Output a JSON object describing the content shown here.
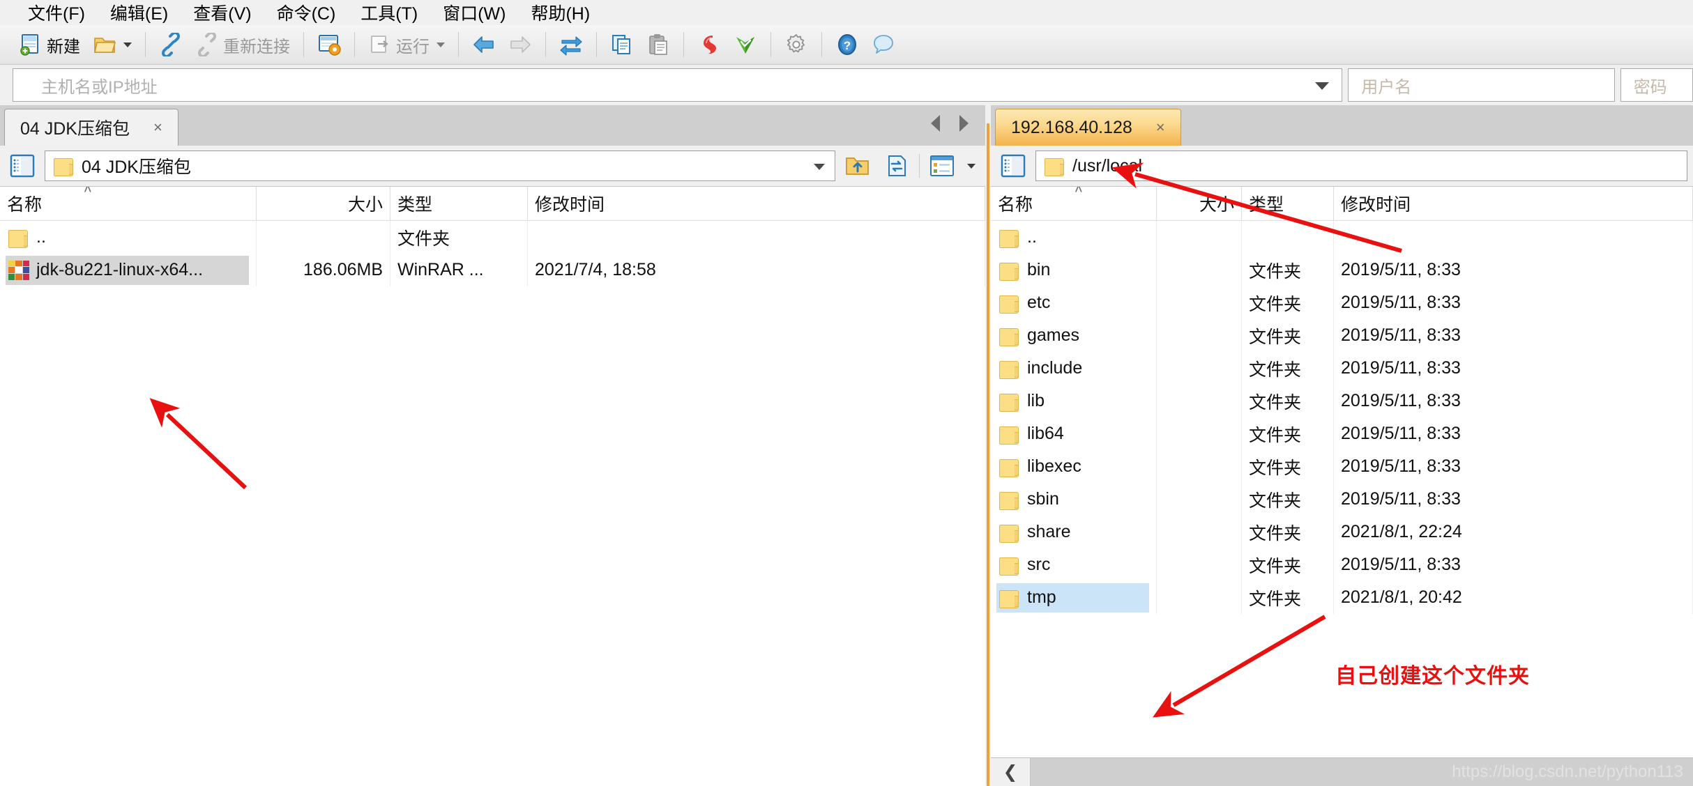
{
  "menubar": {
    "items": [
      {
        "label": "文件(F)",
        "name": "menu-file"
      },
      {
        "label": "编辑(E)",
        "name": "menu-edit"
      },
      {
        "label": "查看(V)",
        "name": "menu-view"
      },
      {
        "label": "命令(C)",
        "name": "menu-command"
      },
      {
        "label": "工具(T)",
        "name": "menu-tools"
      },
      {
        "label": "窗口(W)",
        "name": "menu-window"
      },
      {
        "label": "帮助(H)",
        "name": "menu-help"
      }
    ]
  },
  "toolbar": {
    "new_label": "新建",
    "reconnect_label": "重新连接",
    "run_label": "运行",
    "icons": {
      "new": "new-document-icon",
      "open": "open-folder-icon",
      "connect": "connect-icon",
      "disconnect": "disconnect-icon",
      "transfer": "transfer-window-icon",
      "run": "run-icon",
      "back": "back-arrow-icon",
      "forward": "forward-arrow-icon",
      "sync": "sync-transfer-icon",
      "copy": "copy-icon",
      "paste": "paste-icon",
      "xshell": "xshell-icon",
      "xftp": "xftp-icon",
      "settings": "gear-icon",
      "help": "help-icon",
      "feedback": "feedback-icon"
    }
  },
  "hostbar": {
    "host_placeholder": "主机名或IP地址",
    "user_placeholder": "用户名",
    "password_placeholder": "密码"
  },
  "left_pane": {
    "tab": {
      "label": "04 JDK压缩包",
      "close": "×",
      "active": false
    },
    "address": {
      "path": "04 JDK压缩包"
    },
    "buttons": {
      "toggle_tree": "tree-toggle-icon",
      "up": "up-folder-icon",
      "refresh": "refresh-icon",
      "view": "view-mode-icon"
    },
    "columns": [
      {
        "key": "name",
        "label": "名称",
        "align": "left",
        "sorted": true
      },
      {
        "key": "size",
        "label": "大小",
        "align": "right",
        "sorted": false
      },
      {
        "key": "type",
        "label": "类型",
        "align": "left",
        "sorted": false
      },
      {
        "key": "mtime",
        "label": "修改时间",
        "align": "left",
        "sorted": false
      }
    ],
    "rows": [
      {
        "icon": "folder",
        "name": "..",
        "size": "",
        "type": "文件夹",
        "mtime": "",
        "selected": false
      },
      {
        "icon": "rar",
        "name": "jdk-8u221-linux-x64...",
        "size": "186.06MB",
        "type": "WinRAR ...",
        "mtime": "2021/7/4, 18:58",
        "selected": true
      }
    ]
  },
  "right_pane": {
    "tab": {
      "label": "192.168.40.128",
      "close": "×",
      "active": true
    },
    "address": {
      "path": "/usr/local"
    },
    "buttons": {
      "toggle_tree": "tree-toggle-icon"
    },
    "columns": [
      {
        "key": "name",
        "label": "名称",
        "align": "left",
        "sorted": true
      },
      {
        "key": "size",
        "label": "大小",
        "align": "right",
        "sorted": false
      },
      {
        "key": "type",
        "label": "类型",
        "align": "left",
        "sorted": false
      },
      {
        "key": "mtime",
        "label": "修改时间",
        "align": "left",
        "sorted": false
      }
    ],
    "rows": [
      {
        "icon": "folder",
        "name": "..",
        "size": "",
        "type": "",
        "mtime": "",
        "selected": false
      },
      {
        "icon": "folder",
        "name": "bin",
        "size": "",
        "type": "文件夹",
        "mtime": "2019/5/11, 8:33",
        "selected": false
      },
      {
        "icon": "folder",
        "name": "etc",
        "size": "",
        "type": "文件夹",
        "mtime": "2019/5/11, 8:33",
        "selected": false
      },
      {
        "icon": "folder",
        "name": "games",
        "size": "",
        "type": "文件夹",
        "mtime": "2019/5/11, 8:33",
        "selected": false
      },
      {
        "icon": "folder",
        "name": "include",
        "size": "",
        "type": "文件夹",
        "mtime": "2019/5/11, 8:33",
        "selected": false
      },
      {
        "icon": "folder",
        "name": "lib",
        "size": "",
        "type": "文件夹",
        "mtime": "2019/5/11, 8:33",
        "selected": false
      },
      {
        "icon": "folder",
        "name": "lib64",
        "size": "",
        "type": "文件夹",
        "mtime": "2019/5/11, 8:33",
        "selected": false
      },
      {
        "icon": "folder",
        "name": "libexec",
        "size": "",
        "type": "文件夹",
        "mtime": "2019/5/11, 8:33",
        "selected": false
      },
      {
        "icon": "folder",
        "name": "sbin",
        "size": "",
        "type": "文件夹",
        "mtime": "2019/5/11, 8:33",
        "selected": false
      },
      {
        "icon": "folder",
        "name": "share",
        "size": "",
        "type": "文件夹",
        "mtime": "2021/8/1, 22:24",
        "selected": false
      },
      {
        "icon": "folder",
        "name": "src",
        "size": "",
        "type": "文件夹",
        "mtime": "2019/5/11, 8:33",
        "selected": false
      },
      {
        "icon": "folder",
        "name": "tmp",
        "size": "",
        "type": "文件夹",
        "mtime": "2021/8/1, 20:42",
        "selected": true
      }
    ],
    "scroll_left_arrow": "❮"
  },
  "annotations": {
    "note_text": "自己创建这个文件夹",
    "arrow_color": "#e8110f"
  },
  "watermark": "https://blog.csdn.net/python113",
  "colors": {
    "active_tab": "#f3b34d",
    "selection_blue": "#cce4f7",
    "selection_gray": "#d6d6d6",
    "annotation_red": "#e8110f"
  }
}
